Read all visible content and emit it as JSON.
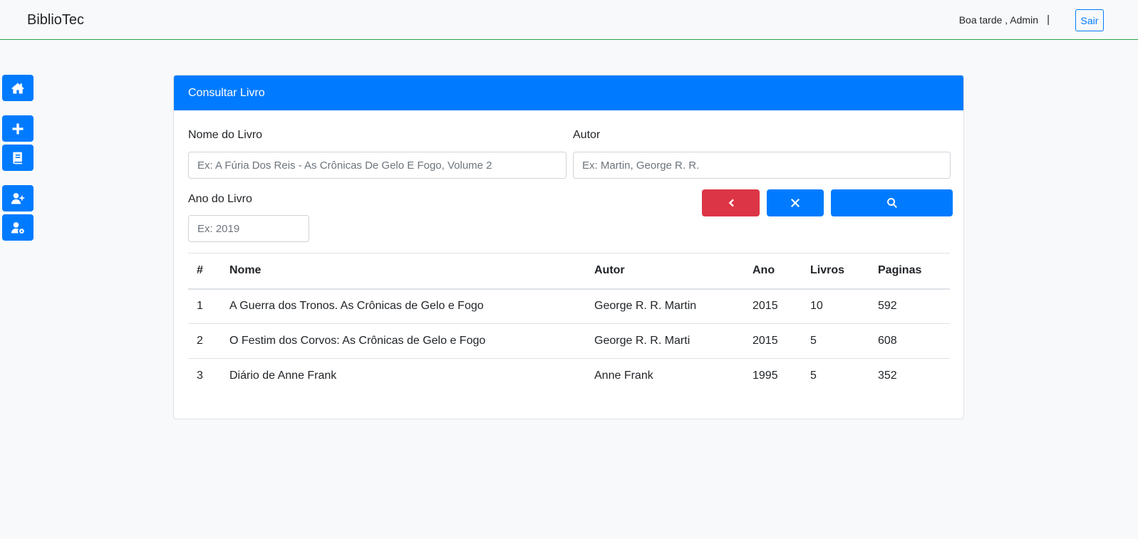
{
  "app": {
    "brand": "BiblioTec"
  },
  "header": {
    "greeting": "Boa tarde , Admin",
    "separator": "|",
    "logout_label": "Sair"
  },
  "sidebar": {
    "items": [
      {
        "icon": "home-icon"
      },
      {
        "icon": "plus-icon"
      },
      {
        "icon": "book-icon"
      },
      {
        "icon": "user-plus-icon"
      },
      {
        "icon": "user-gear-icon"
      }
    ]
  },
  "card": {
    "title": "Consultar Livro",
    "form": {
      "name_label": "Nome do Livro",
      "name_placeholder": "Ex: A Fúria Dos Reis - As Crônicas De Gelo E Fogo, Volume 2",
      "author_label": "Autor",
      "author_placeholder": "Ex: Martin, George R. R.",
      "year_label": "Ano do Livro",
      "year_placeholder": "Ex: 2019"
    },
    "buttons": [
      {
        "icon": "chevron-left-icon",
        "color": "#dc3545"
      },
      {
        "icon": "close-icon",
        "color": "#007bff"
      },
      {
        "icon": "search-icon",
        "color": "#007bff"
      }
    ],
    "table": {
      "headers": [
        "#",
        "Nome",
        "Autor",
        "Ano",
        "Livros",
        "Paginas"
      ],
      "rows": [
        [
          "1",
          "A Guerra dos Tronos. As Crônicas de Gelo e Fogo",
          "George R. R. Martin",
          "2015",
          "10",
          "592"
        ],
        [
          "2",
          "O Festim dos Corvos: As Crônicas de Gelo e Fogo",
          "George R. R. Marti",
          "2015",
          "5",
          "608"
        ],
        [
          "3",
          "Diário de Anne Frank",
          "Anne Frank",
          "1995",
          "5",
          "352"
        ]
      ]
    }
  },
  "colors": {
    "primary": "#007bff",
    "danger": "#dc3545",
    "navbar_border": "#28a745"
  }
}
